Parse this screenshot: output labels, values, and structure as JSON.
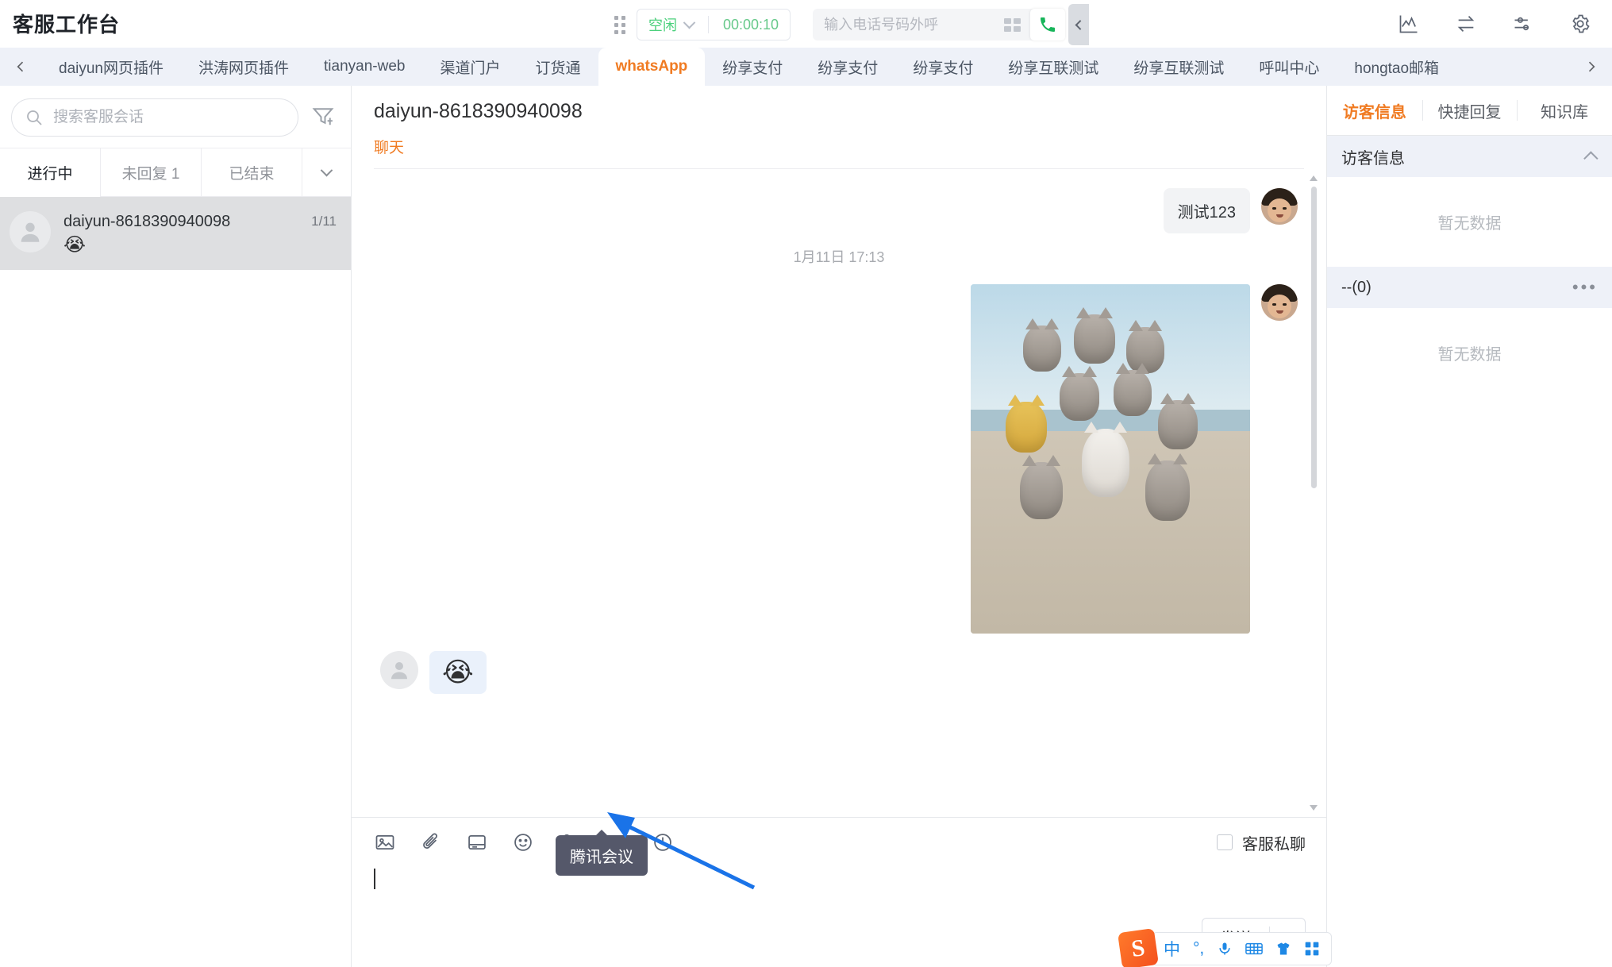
{
  "header": {
    "app_title": "客服工作台",
    "grip_icon": "grid-drag-icon",
    "status_label": "空闲",
    "status_color": "#4cd07d",
    "timer": "00:00:10",
    "dial_placeholder": "输入电话号码外呼",
    "dial_value": "",
    "keypad_icon": "keypad-icon",
    "call_icon": "phone-call-icon",
    "collapse_icon": "chevron-left-icon",
    "right_icons": [
      {
        "name": "analytics-chart-icon"
      },
      {
        "name": "transfer-arrows-icon"
      },
      {
        "name": "sliders-settings-icon"
      },
      {
        "name": "gear-icon"
      }
    ]
  },
  "tabbar": {
    "prev_icon": "chevron-left-icon",
    "next_icon": "chevron-right-icon",
    "active_index": 5,
    "tabs": [
      {
        "label": "daiyun网页插件"
      },
      {
        "label": "洪涛网页插件"
      },
      {
        "label": "tianyan-web"
      },
      {
        "label": "渠道门户"
      },
      {
        "label": "订货通"
      },
      {
        "label": "whatsApp"
      },
      {
        "label": "纷享支付"
      },
      {
        "label": "纷享支付"
      },
      {
        "label": "纷享支付"
      },
      {
        "label": "纷享互联测试"
      },
      {
        "label": "纷享互联测试"
      },
      {
        "label": "呼叫中心"
      },
      {
        "label": "hongtao邮箱"
      }
    ]
  },
  "sidebar": {
    "search_placeholder": "搜索客服会话",
    "search_value": "",
    "search_icon": "search-icon",
    "filter_icon": "filter-icon",
    "segments": [
      {
        "label": "进行中",
        "active": true
      },
      {
        "label": "未回复 1",
        "active": false
      },
      {
        "label": "已结束",
        "active": false
      }
    ],
    "more_caret_icon": "chevron-down-icon",
    "conversations": [
      {
        "name": "daiyun-8618390940098",
        "snippet": "😭",
        "count": "1/11",
        "avatar_icon": "user-placeholder-avatar",
        "selected": true
      }
    ]
  },
  "chat": {
    "title": "daiyun-8618390940098",
    "subtabs": [
      {
        "label": "聊天",
        "active": true
      }
    ],
    "messages": [
      {
        "side": "out",
        "type": "text",
        "text": "测试123"
      },
      {
        "side": "sep",
        "type": "time",
        "text": "1月11日 17:13"
      },
      {
        "side": "out",
        "type": "image",
        "alt": "group-of-cats-on-beach-photo"
      },
      {
        "side": "in",
        "type": "emoji",
        "text": "😭"
      }
    ],
    "scrollbar": {
      "up_icon": "scroll-up-arrow",
      "down_icon": "scroll-down-arrow"
    }
  },
  "composer": {
    "tools": [
      {
        "name": "image-icon",
        "label": "图片"
      },
      {
        "name": "attachment-paperclip-icon",
        "label": "附件"
      },
      {
        "name": "card-icon",
        "label": "名片"
      },
      {
        "name": "emoji-smiley-icon",
        "label": "表情"
      },
      {
        "name": "add-user-icon",
        "label": "添加用户"
      },
      {
        "name": "tencent-meeting-icon",
        "label": "腾讯会议"
      },
      {
        "name": "power-end-session-icon",
        "label": "结束会话"
      }
    ],
    "private_chat_label": "客服私聊",
    "private_chat_checked": false,
    "editor_value": "",
    "tooltip_text": "腾讯会议",
    "send_label": "发送",
    "send_caret_icon": "chevron-down-icon"
  },
  "ime": {
    "logo_text": "S",
    "items": [
      {
        "name": "chinese-mode-icon",
        "label": "中"
      },
      {
        "name": "punctuation-icon",
        "label": "°,"
      },
      {
        "name": "microphone-icon",
        "label": ""
      },
      {
        "name": "keyboard-icon",
        "label": ""
      },
      {
        "name": "skin-theme-icon",
        "label": ""
      },
      {
        "name": "apps-grid-icon",
        "label": ""
      }
    ]
  },
  "right_panel": {
    "tabs": [
      {
        "label": "访客信息",
        "active": true
      },
      {
        "label": "快捷回复",
        "active": false
      },
      {
        "label": "知识库",
        "active": false
      }
    ],
    "sections": [
      {
        "title": "访客信息",
        "collapse_icon": "chevron-up-icon",
        "empty_text": "暂无数据"
      },
      {
        "title": "--(0)",
        "more_icon": "more-dots-icon",
        "empty_text": "暂无数据"
      }
    ]
  },
  "annotation": {
    "arrow_color": "#1a73e8",
    "points_to": "tencent-meeting-icon"
  }
}
